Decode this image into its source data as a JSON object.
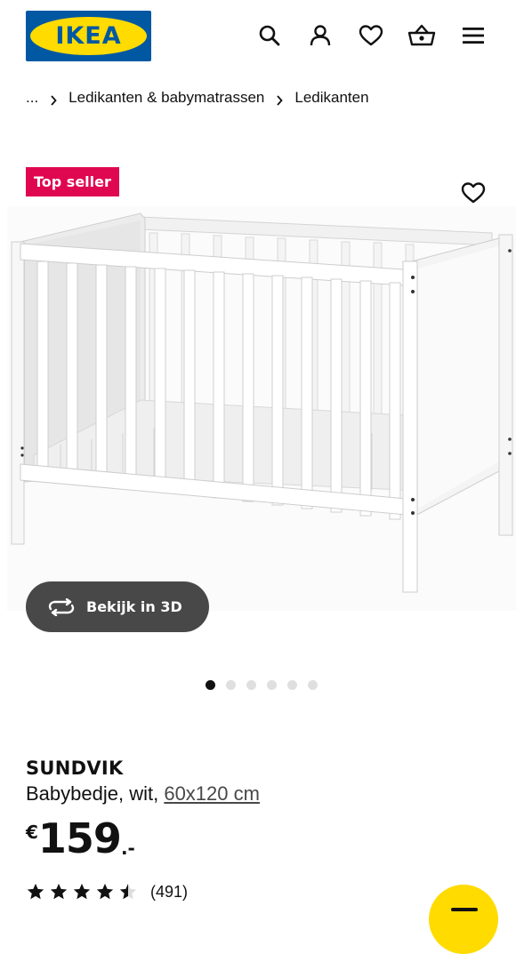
{
  "brand": {
    "logo_text": "IKEA",
    "blue": "#0058a3",
    "yellow": "#ffdb00"
  },
  "header": {
    "icons": [
      "search-icon",
      "account-icon",
      "favorites-icon",
      "basket-icon",
      "menu-icon"
    ]
  },
  "breadcrumb": {
    "ellipsis": "...",
    "items": [
      "Ledikanten & babymatrassen",
      "Ledikanten"
    ]
  },
  "badge": {
    "label": "Top seller",
    "color": "#e00751"
  },
  "view_3d": {
    "label": "Bekijk in 3D"
  },
  "carousel": {
    "total": 6,
    "active": 1
  },
  "product": {
    "name": "SUNDVIK",
    "description": "Babybedje, wit,",
    "size": "60x120 cm",
    "price": {
      "currency": "€",
      "integer": "159",
      "decimal": ".-"
    },
    "rating": {
      "value": 4.5,
      "max": 5,
      "count": "(491)"
    }
  }
}
